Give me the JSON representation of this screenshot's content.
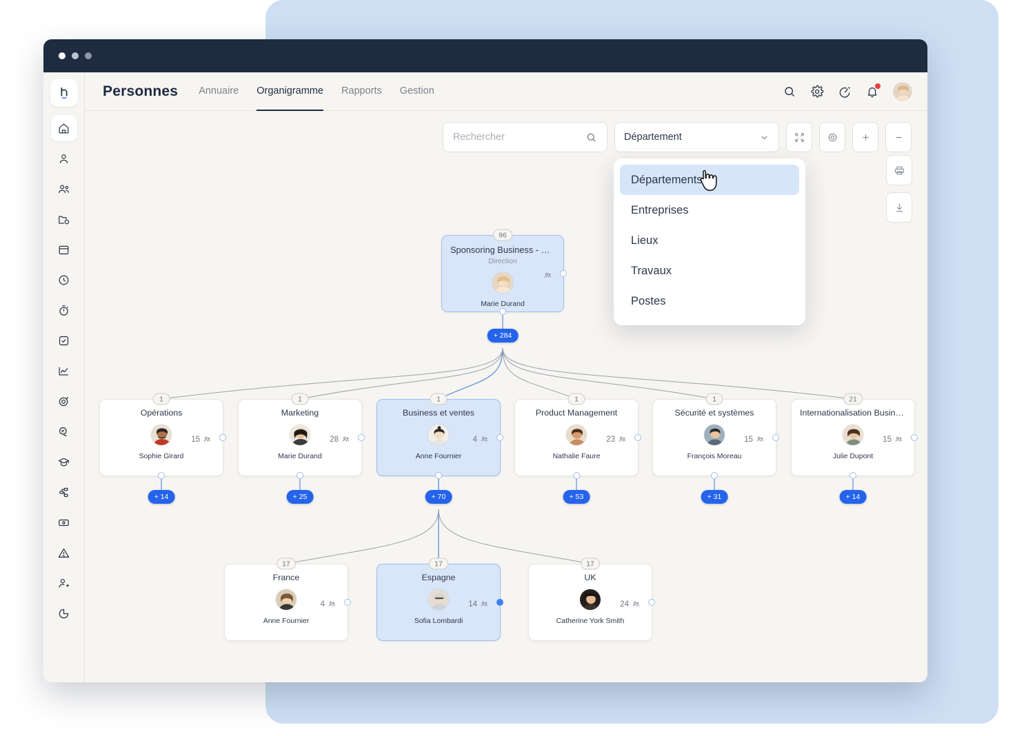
{
  "window": {
    "dots": [
      "close",
      "minimize",
      "maximize"
    ]
  },
  "header": {
    "app_title": "Personnes",
    "nav": [
      {
        "label": "Annuaire",
        "active": false
      },
      {
        "label": "Organigramme",
        "active": true
      },
      {
        "label": "Rapports",
        "active": false
      },
      {
        "label": "Gestion",
        "active": false
      }
    ],
    "icons": [
      "search-icon",
      "gear-icon",
      "speedometer-icon",
      "bell-icon",
      "avatar"
    ]
  },
  "sidebar": {
    "logo": "holaspirit-logo",
    "items": [
      {
        "icon": "home-icon",
        "active": true
      },
      {
        "icon": "user-icon",
        "active": false
      },
      {
        "icon": "users-icon",
        "active": false
      },
      {
        "icon": "folder-clock-icon",
        "active": false
      },
      {
        "icon": "calendar-icon",
        "active": false
      },
      {
        "icon": "clock-icon",
        "active": false
      },
      {
        "icon": "stopwatch-icon",
        "active": false
      },
      {
        "icon": "checkbox-icon",
        "active": false
      },
      {
        "icon": "chart-line-icon",
        "active": false
      },
      {
        "icon": "target-icon",
        "active": false
      },
      {
        "icon": "chat-icon",
        "active": false
      },
      {
        "icon": "graduation-cap-icon",
        "active": false
      },
      {
        "icon": "workflow-icon",
        "active": false
      },
      {
        "icon": "money-icon",
        "active": false
      },
      {
        "icon": "alert-icon",
        "active": false
      },
      {
        "icon": "user-plus-icon",
        "active": false
      },
      {
        "icon": "pie-chart-icon",
        "active": false
      }
    ]
  },
  "toolbar": {
    "search_placeholder": "Rechercher",
    "search_value": "",
    "select_value": "Département",
    "buttons": [
      {
        "name": "fullscreen-button",
        "icon": "expand-icon"
      },
      {
        "name": "recenter-button",
        "icon": "target-circle-icon"
      },
      {
        "name": "zoom-in-button",
        "icon": "plus-icon"
      },
      {
        "name": "zoom-out-button",
        "icon": "minus-icon"
      }
    ],
    "side_buttons": [
      {
        "name": "print-button",
        "icon": "printer-icon"
      },
      {
        "name": "download-button",
        "icon": "download-icon"
      }
    ]
  },
  "dropdown": {
    "open": true,
    "options": [
      {
        "label": "Départements",
        "highlighted": true
      },
      {
        "label": "Entreprises",
        "highlighted": false
      },
      {
        "label": "Lieux",
        "highlighted": false
      },
      {
        "label": "Travaux",
        "highlighted": false
      },
      {
        "label": "Postes",
        "highlighted": false
      }
    ]
  },
  "chart_data": {
    "type": "org-chart",
    "title": "Organigramme — Départements",
    "accent_color": "#2563eb",
    "selected_color": "#d9e6fa",
    "levels": [
      {
        "level": 0,
        "nodes": [
          {
            "id": "root",
            "badge": "96",
            "title": "Sponsoring Business - Operati...",
            "subtitle": "Direction",
            "person": "Marie Durand",
            "member_count": "",
            "selected": true,
            "expand_badge": "+ 284"
          }
        ]
      },
      {
        "level": 1,
        "nodes": [
          {
            "id": "operations",
            "badge": "1",
            "title": "Opérations",
            "person": "Sophie Girard",
            "member_count": "15",
            "selected": false,
            "expand_badge": "+ 14"
          },
          {
            "id": "marketing",
            "badge": "1",
            "title": "Marketing",
            "person": "Marie Durand",
            "member_count": "28",
            "selected": false,
            "expand_badge": "+ 25"
          },
          {
            "id": "business-ventes",
            "badge": "1",
            "title": "Business et ventes",
            "person": "Anne Fournier",
            "member_count": "4",
            "selected": true,
            "expand_badge": "+ 70"
          },
          {
            "id": "product-management",
            "badge": "1",
            "title": "Product Management",
            "person": "Nathalie Faure",
            "member_count": "23",
            "selected": false,
            "expand_badge": "+ 53"
          },
          {
            "id": "securite-systemes",
            "badge": "1",
            "title": "Sécurité et systèmes",
            "person": "François Moreau",
            "member_count": "15",
            "selected": false,
            "expand_badge": "+ 31"
          },
          {
            "id": "internationalisation",
            "badge": "21",
            "title": "Internationalisation Business St...",
            "person": "Julie Dupont",
            "member_count": "15",
            "selected": false,
            "expand_badge": "+ 14"
          }
        ]
      },
      {
        "level": 2,
        "nodes": [
          {
            "id": "france",
            "badge": "17",
            "title": "France",
            "person": "Anne Fournier",
            "member_count": "4",
            "selected": false
          },
          {
            "id": "espagne",
            "badge": "17",
            "title": "Espagne",
            "person": "Sofia Lombardi",
            "member_count": "14",
            "selected": true
          },
          {
            "id": "uk",
            "badge": "17",
            "title": "UK",
            "person": "Catherine York Smith",
            "member_count": "24",
            "selected": false
          }
        ]
      }
    ]
  }
}
